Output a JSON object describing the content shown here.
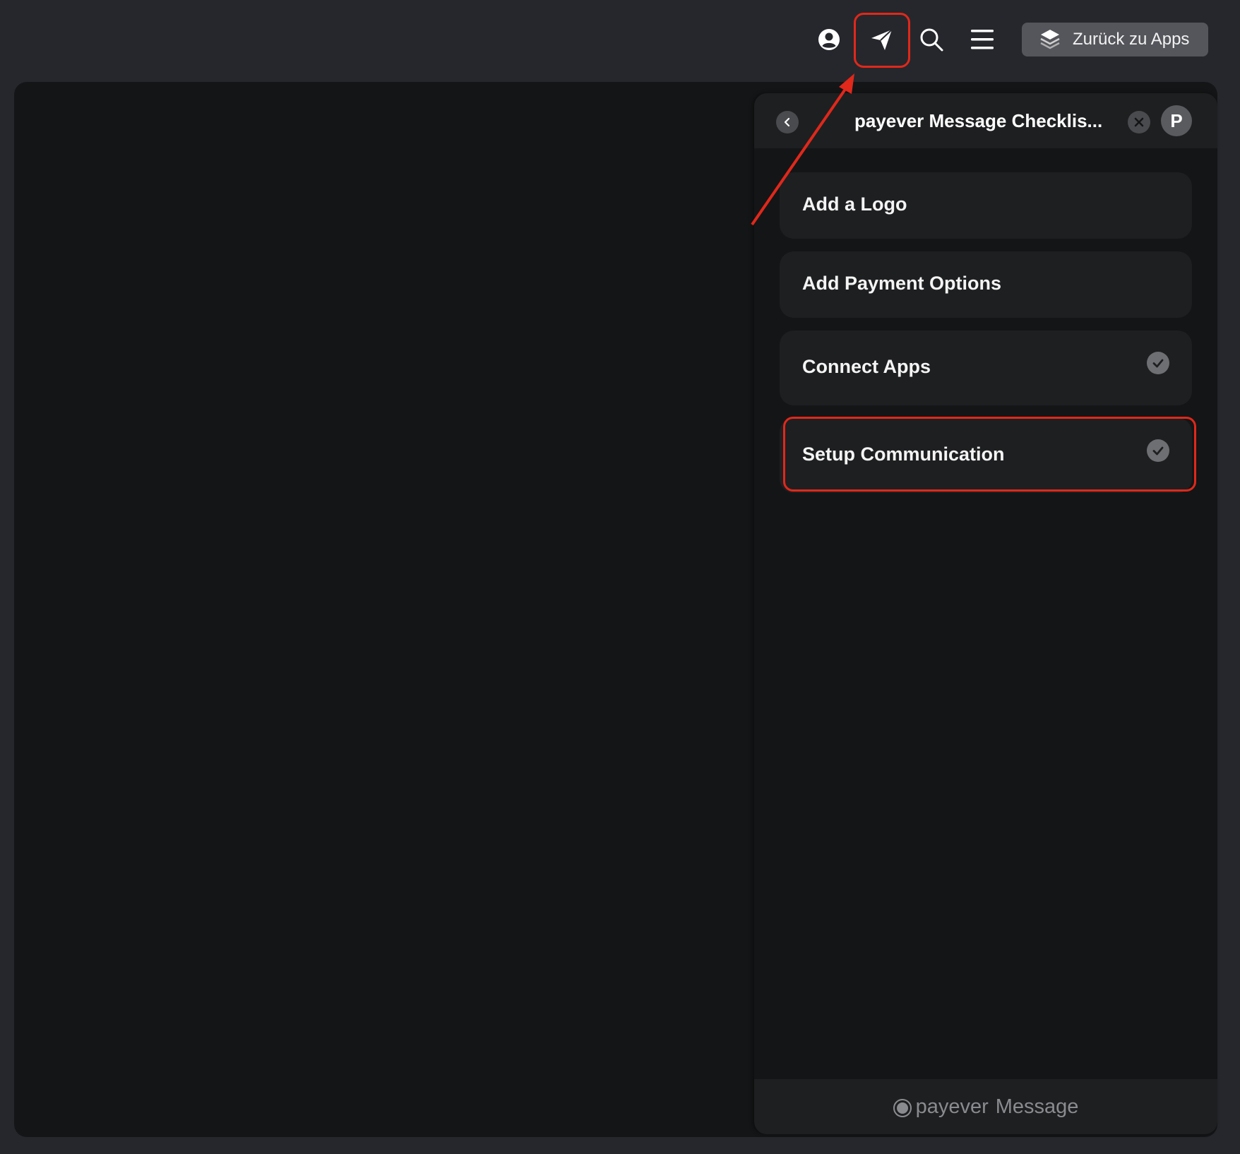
{
  "topbar": {
    "icons": [
      "user-circle-icon",
      "send-icon",
      "search-icon",
      "menu-icon",
      "layers-icon"
    ],
    "back_to_apps_label": "Zurück zu Apps"
  },
  "panel": {
    "title": "payever Message Checklis...",
    "avatar_letter": "P",
    "items": [
      {
        "label": "Add a Logo",
        "checked": false
      },
      {
        "label": "Add Payment Options",
        "checked": false
      },
      {
        "label": "Connect Apps",
        "checked": true
      },
      {
        "label": "Setup Communication",
        "checked": true
      }
    ],
    "footer": {
      "brand": "payever",
      "product": "Message"
    }
  },
  "annotation_color": "#e0281b"
}
